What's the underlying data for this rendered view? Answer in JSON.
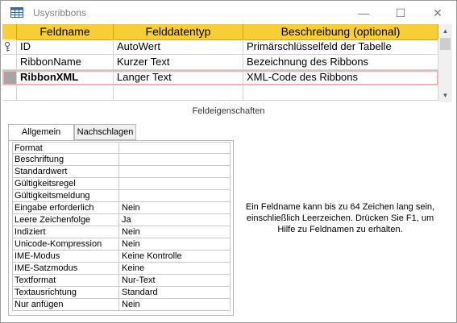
{
  "window": {
    "title": "Usysribbons",
    "controls": {
      "minimize": "—",
      "maximize": "☐",
      "close": "✕"
    }
  },
  "grid": {
    "headers": {
      "name": "Feldname",
      "type": "Felddatentyp",
      "desc": "Beschreibung (optional)"
    },
    "rows": [
      {
        "name": "ID",
        "type": "AutoWert",
        "desc": "Primärschlüsselfeld der Tabelle",
        "key": true
      },
      {
        "name": "RibbonName",
        "type": "Kurzer Text",
        "desc": "Bezeichnung des Ribbons"
      },
      {
        "name": "RibbonXML",
        "type": "Langer Text",
        "desc": "XML-Code des Ribbons",
        "current": true
      },
      {
        "name": "",
        "type": "",
        "desc": ""
      }
    ]
  },
  "properties": {
    "section_label": "Feldeigenschaften",
    "tabs": [
      {
        "label": "Allgemein",
        "active": true
      },
      {
        "label": "Nachschlagen",
        "active": false
      }
    ],
    "rows": [
      {
        "label": "Format",
        "value": ""
      },
      {
        "label": "Beschriftung",
        "value": ""
      },
      {
        "label": "Standardwert",
        "value": ""
      },
      {
        "label": "Gültigkeitsregel",
        "value": ""
      },
      {
        "label": "Gültigkeitsmeldung",
        "value": ""
      },
      {
        "label": "Eingabe erforderlich",
        "value": "Nein"
      },
      {
        "label": "Leere Zeichenfolge",
        "value": "Ja"
      },
      {
        "label": "Indiziert",
        "value": "Nein"
      },
      {
        "label": "Unicode-Kompression",
        "value": "Nein"
      },
      {
        "label": "IME-Modus",
        "value": "Keine Kontrolle"
      },
      {
        "label": "IME-Satzmodus",
        "value": "Keine"
      },
      {
        "label": "Textformat",
        "value": "Nur-Text"
      },
      {
        "label": "Textausrichtung",
        "value": "Standard"
      },
      {
        "label": "Nur anfügen",
        "value": "Nein"
      }
    ]
  },
  "help_text": "Ein Feldname kann bis zu 64 Zeichen lang sein, einschließlich Leerzeichen. Drücken Sie F1, um Hilfe zu Feldnamen zu erhalten.",
  "colors": {
    "header_bg": "#f7ce36",
    "current_row_outline": "#f0b3b8",
    "row_selector_current": "#a6a6a6"
  }
}
